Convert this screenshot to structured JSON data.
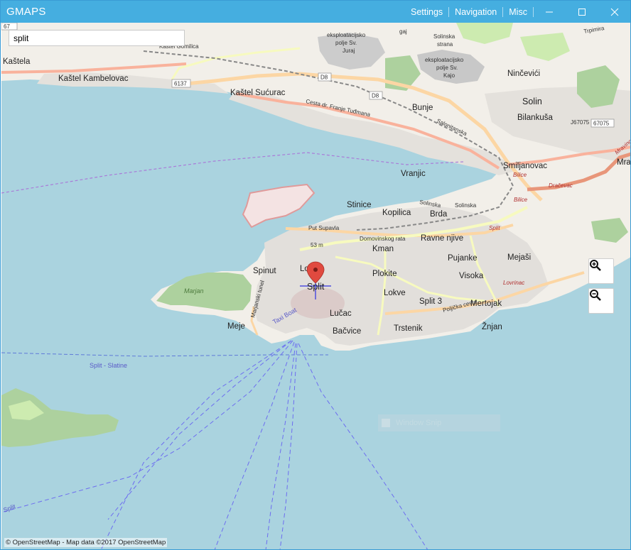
{
  "window": {
    "title": "GMAPS",
    "menu": [
      "Settings",
      "Navigation",
      "Misc"
    ],
    "controls": [
      "minimize-icon",
      "maximize-icon",
      "close-icon"
    ]
  },
  "search": {
    "value": "split"
  },
  "map": {
    "marker": {
      "label": "Split"
    },
    "places": {
      "kastela": "Kaštela",
      "kambelovac": "Kaštel Kambelovac",
      "sucurac": "Kaštel Sućurac",
      "gomilica": "Kaštel Gomilica",
      "bunje": "Bunje",
      "solin": "Solin",
      "bilankusa": "Bilankuša",
      "nincevici": "Ninčevići",
      "smiljanovac": "Smiljanovac",
      "mravince": "Mravi",
      "mra": "Mra",
      "vranjic": "Vranjic",
      "stinice": "Stinice",
      "kopilica": "Kopilica",
      "brda": "Brda",
      "ravne_njive": "Ravne njive",
      "kman": "Kman",
      "pujanke": "Pujanke",
      "mejasi": "Mejaši",
      "spinut": "Spinut",
      "lora": "Lor",
      "plokite": "Plokite",
      "visoka": "Visoka",
      "lokve": "Lokve",
      "split3": "Split 3",
      "mertojak": "Mertojak",
      "lucac": "Lučac",
      "meje": "Meje",
      "bacvice": "Bačvice",
      "trstenik": "Trstenik",
      "znjan": "Žnjan",
      "marjan": "Marjan",
      "split_slatine": "Split - Slatine",
      "split_sw": "Split",
      "eksp1_a": "eksploatacijsko",
      "eksp1_b": "polje Sv.",
      "eksp1_c": "Juraj",
      "eksp2_a": "eksploatacijsko",
      "eksp2_b": "polje Sv.",
      "eksp2_c": "Kajo",
      "solinska_a": "Solinska",
      "solinska_b": "strana",
      "gaj": "gaj"
    },
    "roads": {
      "d8_a": "D8",
      "d8_b": "D8",
      "r6137": "6137",
      "r67075": "67075",
      "r67": "67",
      "cesta": "Cesta dr. Franje Tuđmana",
      "salonitanska": "Salonitanska",
      "solinska1": "Solinska",
      "solinska2": "Solinska",
      "put_supavla": "Put Supavla",
      "domovinskog": "Domovinskog rata",
      "poljicka": "Poljička cesta",
      "marjanski": "Marjanski tunel",
      "taxi_boat": "Taxi Boat",
      "trpimira": "Trpimira",
      "bilice1": "Bilice",
      "bilice2": "Bilice",
      "dracevac": "Dračevac",
      "lovrinac": "Lovrinac",
      "split_red": "Split",
      "elev": "53 m",
      "mravince_road": "Mravinc",
      "j67075": "J67075"
    },
    "zoom": {
      "in_icon": "zoom-in-icon",
      "out_icon": "zoom-out-icon"
    },
    "attribution": "© OpenStreetMap - Map data ©2017 OpenStreetMap",
    "overlay": "Window Snip"
  },
  "colors": {
    "titlebar": "#45aee0",
    "water": "#aad3df",
    "land": "#f2efe9",
    "urban": "#e0dfdf",
    "park": "#cdebb0",
    "forest": "#add19e",
    "motorway": "#f9b29c",
    "primary": "#fcd6a4",
    "secondary": "#f7fabf",
    "marker": "#e04a3f",
    "ferry": "#6d6df0"
  }
}
